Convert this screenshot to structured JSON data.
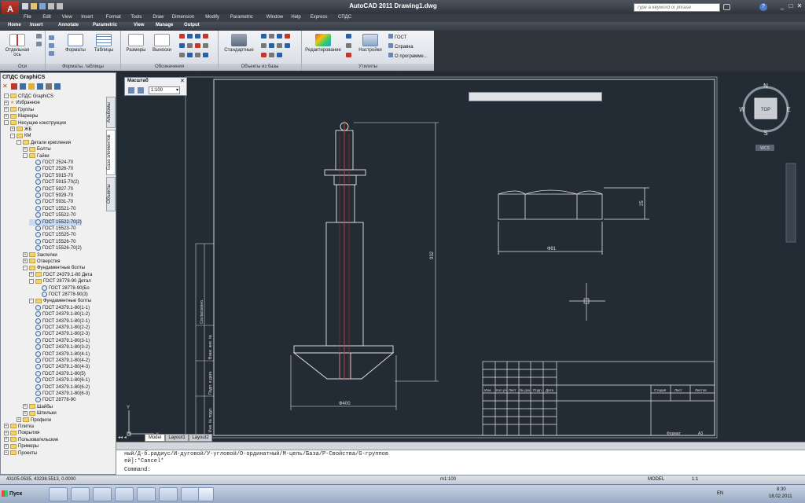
{
  "window": {
    "title": "AutoCAD 2011   Drawing1.dwg",
    "search_placeholder": "Type a keyword or phrase"
  },
  "menu": [
    "File",
    "Edit",
    "View",
    "Insert",
    "Format",
    "Tools",
    "Draw",
    "Dimension",
    "Modify",
    "Parametric",
    "Window",
    "Help",
    "Express",
    "СПДС"
  ],
  "ribbon_tabs": [
    "Home",
    "Insert",
    "Annotate",
    "Parametric",
    "View",
    "Manage",
    "Output"
  ],
  "ribbon": {
    "buttons": {
      "axis": "Отдельная ось",
      "formats": "Форматы",
      "tables": "Таблицы",
      "dims": "Размеры",
      "leaders": "Выноски",
      "standard": "Стандартные",
      "edit": "Редактирование",
      "settings": "Настройки"
    },
    "panels": {
      "axes": "Оси",
      "formats": "Форматы, таблицы",
      "notation": "Обозначения",
      "base": "Объекты из базы",
      "utils": "Утилиты"
    },
    "links": [
      "ГОСТ",
      "Справка",
      "О программе..."
    ]
  },
  "palette": {
    "title": "СПДС GraphiCS",
    "vtabs": [
      "Альбомы",
      "База элементов",
      "Объекты"
    ],
    "tree": [
      {
        "indent": 0,
        "sign": "-",
        "icon": "folder",
        "label": "СПДС GraphiCS"
      },
      {
        "indent": 0,
        "sign": "+",
        "icon": "star",
        "label": "Избранное"
      },
      {
        "indent": 0,
        "sign": "+",
        "icon": "folder",
        "label": "Группы"
      },
      {
        "indent": 0,
        "sign": "+",
        "icon": "folder",
        "label": "Маркеры"
      },
      {
        "indent": 0,
        "sign": "-",
        "icon": "folder",
        "label": "Несущие конструкции"
      },
      {
        "indent": 1,
        "sign": "+",
        "icon": "folder",
        "label": "ЖБ"
      },
      {
        "indent": 1,
        "sign": "-",
        "icon": "folder",
        "label": "КМ"
      },
      {
        "indent": 2,
        "sign": "-",
        "icon": "folder",
        "label": "Детали крепления"
      },
      {
        "indent": 3,
        "sign": "+",
        "icon": "folder",
        "label": "Болты"
      },
      {
        "indent": 3,
        "sign": "-",
        "icon": "folder",
        "label": "Гайки"
      },
      {
        "indent": 4,
        "sign": "",
        "icon": "bolt",
        "label": "ГОСТ 2524-70"
      },
      {
        "indent": 4,
        "sign": "",
        "icon": "bolt",
        "label": "ГОСТ 2526-70"
      },
      {
        "indent": 4,
        "sign": "",
        "icon": "bolt",
        "label": "ГОСТ 5915-70"
      },
      {
        "indent": 4,
        "sign": "",
        "icon": "bolt",
        "label": "ГОСТ 5915-70(2)"
      },
      {
        "indent": 4,
        "sign": "",
        "icon": "bolt",
        "label": "ГОСТ 5927-70"
      },
      {
        "indent": 4,
        "sign": "",
        "icon": "bolt",
        "label": "ГОСТ 5929-70"
      },
      {
        "indent": 4,
        "sign": "",
        "icon": "bolt",
        "label": "ГОСТ 5931-70"
      },
      {
        "indent": 4,
        "sign": "",
        "icon": "bolt",
        "label": "ГОСТ 15521-70"
      },
      {
        "indent": 4,
        "sign": "",
        "icon": "bolt",
        "label": "ГОСТ 15522-70"
      },
      {
        "indent": 4,
        "sign": "",
        "icon": "bolt",
        "label": "ГОСТ 15522-70(2)",
        "selected": true
      },
      {
        "indent": 4,
        "sign": "",
        "icon": "bolt",
        "label": "ГОСТ 15523-70"
      },
      {
        "indent": 4,
        "sign": "",
        "icon": "bolt",
        "label": "ГОСТ 15525-70"
      },
      {
        "indent": 4,
        "sign": "",
        "icon": "bolt",
        "label": "ГОСТ 15526-70"
      },
      {
        "indent": 4,
        "sign": "",
        "icon": "bolt",
        "label": "ГОСТ 15526-70(2)"
      },
      {
        "indent": 3,
        "sign": "+",
        "icon": "folder",
        "label": "Заклепки"
      },
      {
        "indent": 3,
        "sign": "+",
        "icon": "folder",
        "label": "Отверстия"
      },
      {
        "indent": 3,
        "sign": "-",
        "icon": "folder",
        "label": "Фундаментные болты"
      },
      {
        "indent": 4,
        "sign": "+",
        "icon": "folder",
        "label": "ГОСТ 24379.1-80 Дета"
      },
      {
        "indent": 4,
        "sign": "-",
        "icon": "folder",
        "label": "ГОСТ 28778-90 Детал"
      },
      {
        "indent": 5,
        "sign": "",
        "icon": "bolt",
        "label": "ГОСТ 28778-90(Бо"
      },
      {
        "indent": 5,
        "sign": "",
        "icon": "bolt",
        "label": "ГОСТ 28778-90(3)"
      },
      {
        "indent": 4,
        "sign": "-",
        "icon": "folder",
        "label": "Фундаментные болты"
      },
      {
        "indent": 4,
        "sign": "",
        "icon": "bolt",
        "label": "ГОСТ 24379.1-80(1-1)"
      },
      {
        "indent": 4,
        "sign": "",
        "icon": "bolt",
        "label": "ГОСТ 24379.1-80(1-2)"
      },
      {
        "indent": 4,
        "sign": "",
        "icon": "bolt",
        "label": "ГОСТ 24379.1-80(2-1)"
      },
      {
        "indent": 4,
        "sign": "",
        "icon": "bolt",
        "label": "ГОСТ 24379.1-80(2-2)"
      },
      {
        "indent": 4,
        "sign": "",
        "icon": "bolt",
        "label": "ГОСТ 24379.1-80(2-3)"
      },
      {
        "indent": 4,
        "sign": "",
        "icon": "bolt",
        "label": "ГОСТ 24379.1-80(3-1)"
      },
      {
        "indent": 4,
        "sign": "",
        "icon": "bolt",
        "label": "ГОСТ 24379.1-80(3-2)"
      },
      {
        "indent": 4,
        "sign": "",
        "icon": "bolt",
        "label": "ГОСТ 24379.1-80(4-1)"
      },
      {
        "indent": 4,
        "sign": "",
        "icon": "bolt",
        "label": "ГОСТ 24379.1-80(4-2)"
      },
      {
        "indent": 4,
        "sign": "",
        "icon": "bolt",
        "label": "ГОСТ 24379.1-80(4-3)"
      },
      {
        "indent": 4,
        "sign": "",
        "icon": "bolt",
        "label": "ГОСТ 24379.1-80(5)"
      },
      {
        "indent": 4,
        "sign": "",
        "icon": "bolt",
        "label": "ГОСТ 24379.1-80(6-1)"
      },
      {
        "indent": 4,
        "sign": "",
        "icon": "bolt",
        "label": "ГОСТ 24379.1-80(6-2)"
      },
      {
        "indent": 4,
        "sign": "",
        "icon": "bolt",
        "label": "ГОСТ 24379.1-80(6-3)"
      },
      {
        "indent": 4,
        "sign": "",
        "icon": "bolt",
        "label": "ГОСТ 28778-90"
      },
      {
        "indent": 3,
        "sign": "+",
        "icon": "folder",
        "label": "Шайбы"
      },
      {
        "indent": 3,
        "sign": "+",
        "icon": "folder",
        "label": "Шпильки"
      },
      {
        "indent": 2,
        "sign": "+",
        "icon": "folder",
        "label": "Профили"
      },
      {
        "indent": 0,
        "sign": "+",
        "icon": "folder",
        "label": "Плитка"
      },
      {
        "indent": 0,
        "sign": "+",
        "icon": "folder",
        "label": "Покрытия"
      },
      {
        "indent": 0,
        "sign": "+",
        "icon": "folder",
        "label": "Пользовательские"
      },
      {
        "indent": 0,
        "sign": "+",
        "icon": "folder",
        "label": "Примеры"
      },
      {
        "indent": 0,
        "sign": "+",
        "icon": "folder",
        "label": "Проекты"
      }
    ]
  },
  "scale_panel": {
    "title": "Масштаб",
    "value": "1:100"
  },
  "viewcube": {
    "n": "N",
    "s": "S",
    "e": "E",
    "w": "W",
    "face": "TOP",
    "wcs": "WCS"
  },
  "drawing_labels": {
    "dim_height": "932",
    "dim_width_bottom": "Ф400",
    "dim_nut_width": "Ф81",
    "dim_nut_height": "25",
    "sheet_format": "Формат",
    "sheet_size": "A3",
    "title_cols": [
      "Изм.",
      "Кол.уч.",
      "Лист",
      "№ док.",
      "Подп.",
      "Дата"
    ],
    "title_right": [
      "Стадия",
      "Лист",
      "Листов"
    ],
    "side_stamps": [
      "Согласовано",
      "Взам. инв. №",
      "Подп. и дата",
      "Инв. № подл."
    ]
  },
  "layout_tabs": [
    "Model",
    "Layout1",
    "Layout2"
  ],
  "command": {
    "line1": "ный/Д-б.радиус/И-дуговой/У-угловой/О-ординатный/М-цель/База/Р-Свойства/G-группов",
    "line2": "ей]:*Cancel*",
    "prompt": "Command:"
  },
  "status": {
    "coords": "43105.0535, 43238.5513, 0.0000",
    "scale": "m1:100",
    "model": "MODEL",
    "anno": "1:1"
  },
  "taskbar": {
    "start": "Пуск",
    "lang": "EN",
    "time": "8:30",
    "date": "18.02.2011"
  }
}
